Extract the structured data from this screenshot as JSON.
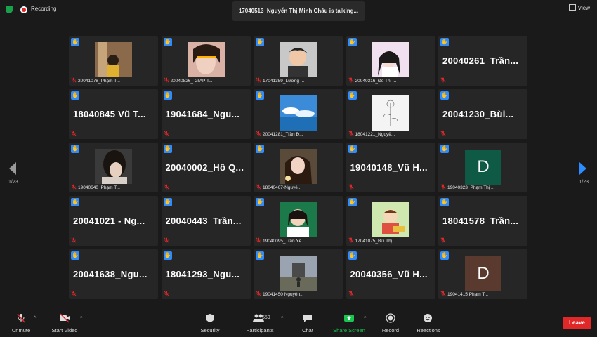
{
  "topbar": {
    "recording_label": "Recording",
    "talking_text": "17040513_Nguyễn Thị Minh Châu is talking...",
    "view_label": "View"
  },
  "pagination": {
    "left": "1/23",
    "right": "1/23"
  },
  "colors": {
    "hand": "#2d8cff",
    "leave": "#e02828",
    "share_screen": "#19c650",
    "mic_muted": "#e02828"
  },
  "tiles": [
    {
      "kind": "photo",
      "name": "20041078_Phạm T...",
      "photo": "p1"
    },
    {
      "kind": "photo",
      "name": "20040826_ GIÁP T...",
      "photo": "p2"
    },
    {
      "kind": "photo",
      "name": "17041359_Lương ...",
      "photo": "p3"
    },
    {
      "kind": "photo",
      "name": "20040316_Đỗ Thị ...",
      "photo": "p4"
    },
    {
      "kind": "text",
      "big": "20040261_Trần..."
    },
    {
      "kind": "text",
      "big": "18040845   Vũ T..."
    },
    {
      "kind": "text",
      "big": "19041684_Ngu..."
    },
    {
      "kind": "photo",
      "name": "20041281_Trần Đ...",
      "photo": "p5"
    },
    {
      "kind": "photo",
      "name": "18041221_Nguyễ...",
      "photo": "p6"
    },
    {
      "kind": "text",
      "big": "20041230_Bùi..."
    },
    {
      "kind": "photo",
      "name": "19040640_Phạm T...",
      "photo": "p7"
    },
    {
      "kind": "text",
      "big": "20040002_Hồ  Q..."
    },
    {
      "kind": "photo",
      "name": "18040467-Nguyễ...",
      "photo": "p8"
    },
    {
      "kind": "text",
      "big": "19040148_Vũ  H..."
    },
    {
      "kind": "avatar",
      "name": "19040323_Phạm Thị ...",
      "letter": "D",
      "bg": "#0f5a44"
    },
    {
      "kind": "text",
      "big": "20041021  -  Ng..."
    },
    {
      "kind": "text",
      "big": "20040443_Trần..."
    },
    {
      "kind": "photo",
      "name": "19040095_Trần Yế...",
      "photo": "p9"
    },
    {
      "kind": "photo",
      "name": "17041075_Bùi Thị ...",
      "photo": "p10"
    },
    {
      "kind": "text",
      "big": "18041578_Trần..."
    },
    {
      "kind": "text",
      "big": "20041638_Ngu..."
    },
    {
      "kind": "text",
      "big": "18041293_Ngu..."
    },
    {
      "kind": "photo",
      "name": "19041450 Nguyễn...",
      "photo": "p11"
    },
    {
      "kind": "text",
      "big": "20040356_Vũ  H..."
    },
    {
      "kind": "avatar",
      "name": "19041415 Phạm T...",
      "letter": "D",
      "bg": "#5a3a2e"
    }
  ],
  "toolbar": {
    "unmute": "Unmute",
    "start_video": "Start Video",
    "security": "Security",
    "participants": "Participants",
    "participants_count": "559",
    "chat": "Chat",
    "share_screen": "Share Screen",
    "record": "Record",
    "reactions": "Reactions",
    "leave": "Leave"
  }
}
